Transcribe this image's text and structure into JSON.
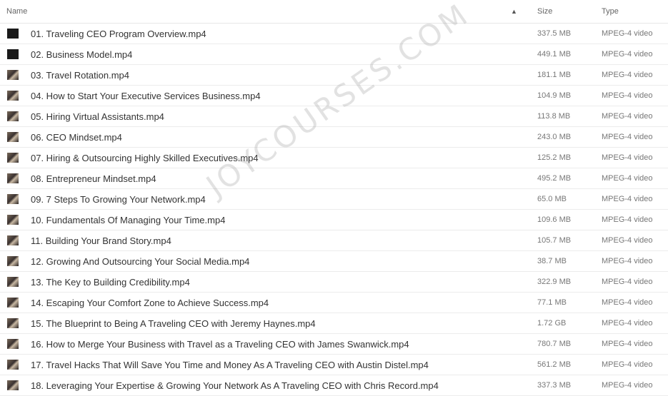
{
  "header": {
    "name": "Name",
    "sort": "▲",
    "size": "Size",
    "type": "Type"
  },
  "files": [
    {
      "name": "01. Traveling CEO Program Overview.mp4",
      "size": "337.5 MB",
      "type": "MPEG-4 video",
      "thumb": "black-thumbnail"
    },
    {
      "name": "02. Business Model.mp4",
      "size": "449.1 MB",
      "type": "MPEG-4 video",
      "thumb": "black-thumbnail"
    },
    {
      "name": "03. Travel Rotation.mp4",
      "size": "181.1 MB",
      "type": "MPEG-4 video",
      "thumb": "photo-thumbnail"
    },
    {
      "name": "04. How to Start Your Executive Services Business.mp4",
      "size": "104.9 MB",
      "type": "MPEG-4 video",
      "thumb": "photo-thumbnail"
    },
    {
      "name": "05. Hiring Virtual Assistants.mp4",
      "size": "113.8 MB",
      "type": "MPEG-4 video",
      "thumb": "photo-thumbnail"
    },
    {
      "name": "06. CEO Mindset.mp4",
      "size": "243.0 MB",
      "type": "MPEG-4 video",
      "thumb": "photo-thumbnail"
    },
    {
      "name": "07. Hiring & Outsourcing Highly Skilled Executives.mp4",
      "size": "125.2 MB",
      "type": "MPEG-4 video",
      "thumb": "photo-thumbnail"
    },
    {
      "name": "08. Entrepreneur Mindset.mp4",
      "size": "495.2 MB",
      "type": "MPEG-4 video",
      "thumb": "photo-thumbnail"
    },
    {
      "name": "09. 7 Steps To Growing Your Network.mp4",
      "size": "65.0 MB",
      "type": "MPEG-4 video",
      "thumb": "photo-thumbnail"
    },
    {
      "name": "10. Fundamentals Of Managing Your Time.mp4",
      "size": "109.6 MB",
      "type": "MPEG-4 video",
      "thumb": "photo-thumbnail"
    },
    {
      "name": "11. Building Your Brand Story.mp4",
      "size": "105.7 MB",
      "type": "MPEG-4 video",
      "thumb": "photo-thumbnail"
    },
    {
      "name": "12. Growing And Outsourcing Your Social Media.mp4",
      "size": "38.7 MB",
      "type": "MPEG-4 video",
      "thumb": "photo-thumbnail"
    },
    {
      "name": "13. The Key to Building Credibility.mp4",
      "size": "322.9 MB",
      "type": "MPEG-4 video",
      "thumb": "photo-thumbnail"
    },
    {
      "name": "14. Escaping Your Comfort Zone to Achieve Success.mp4",
      "size": "77.1 MB",
      "type": "MPEG-4 video",
      "thumb": "photo-thumbnail"
    },
    {
      "name": "15. The Blueprint to Being A Traveling CEO with Jeremy Haynes.mp4",
      "size": "1.72 GB",
      "type": "MPEG-4 video",
      "thumb": "photo-thumbnail"
    },
    {
      "name": "16. How to Merge Your Business with Travel as a Traveling CEO with James Swanwick.mp4",
      "size": "780.7 MB",
      "type": "MPEG-4 video",
      "thumb": "photo-thumbnail"
    },
    {
      "name": "17. Travel Hacks That Will Save You Time and Money As A Traveling CEO with Austin Distel.mp4",
      "size": "561.2 MB",
      "type": "MPEG-4 video",
      "thumb": "photo-thumbnail"
    },
    {
      "name": "18. Leveraging Your Expertise & Growing Your Network As A Traveling CEO with Chris Record.mp4",
      "size": "337.3 MB",
      "type": "MPEG-4 video",
      "thumb": "photo-thumbnail"
    }
  ],
  "watermark": "JOYCOURSES.COM"
}
